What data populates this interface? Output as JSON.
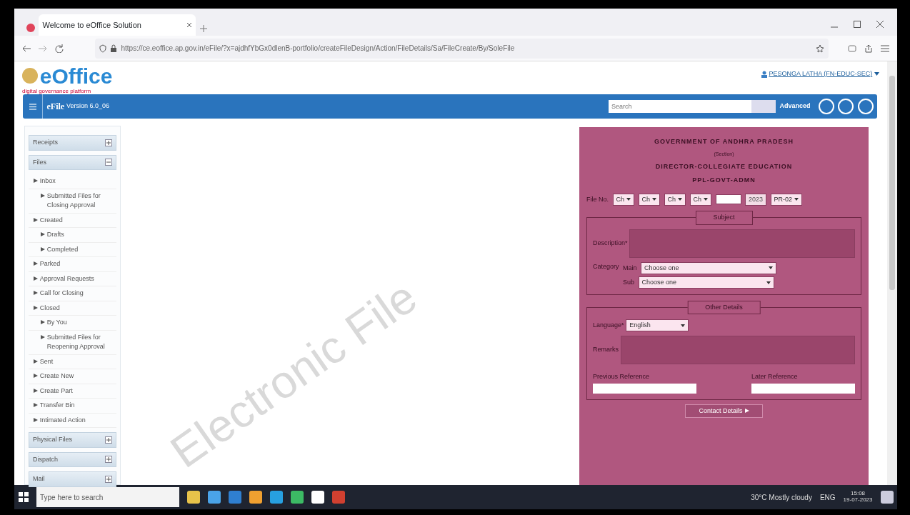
{
  "browser": {
    "tab_title": "Welcome to eOffice Solution",
    "url": "https://ce.eoffice.ap.gov.in/eFile/?x=ajdhfYbGx0dlenB-portfolio/createFileDesign/Action/FileDetails/Sa/FileCreate/By/SoleFile"
  },
  "app": {
    "logo": "eOffice",
    "logo_tagline": "digital governance platform",
    "user": "PESONGA LATHA (FN-EDUC-SEC)",
    "title": "eFile",
    "version": "Version 6.0_06",
    "search_placeholder": "Search",
    "advanced": "Advanced"
  },
  "sidebar": [
    {
      "label": "Receipts",
      "expanded": false
    },
    {
      "label": "Files",
      "expanded": true,
      "children": [
        {
          "label": "Inbox",
          "children": [
            {
              "label": "Submitted Files for Closing Approval"
            }
          ]
        },
        {
          "label": "Created",
          "children": [
            {
              "label": "Drafts"
            },
            {
              "label": "Completed"
            }
          ]
        },
        {
          "label": "Parked"
        },
        {
          "label": "Approval Requests"
        },
        {
          "label": "Call for Closing"
        },
        {
          "label": "Closed",
          "children": [
            {
              "label": "By You"
            },
            {
              "label": "Submitted Files for Reopening Approval"
            }
          ]
        },
        {
          "label": "Sent"
        },
        {
          "label": "Create New"
        },
        {
          "label": "Create Part"
        },
        {
          "label": "Transfer Bin"
        },
        {
          "label": "Intimated Action"
        }
      ]
    },
    {
      "label": "Physical Files",
      "expanded": false
    },
    {
      "label": "Dispatch",
      "expanded": false
    },
    {
      "label": "Mail",
      "expanded": false
    }
  ],
  "watermark": "Electronic File",
  "form": {
    "heading": [
      "GOVERNMENT OF ANDHRA PRADESH",
      "(Section)",
      "DIRECTOR-COLLEGIATE EDUCATION",
      "PPL-GOVT-ADMN"
    ],
    "file_no_label": "File No.",
    "file_no": [
      {
        "kind": "select",
        "value": "Ch"
      },
      {
        "kind": "select",
        "value": "Ch"
      },
      {
        "kind": "select",
        "value": "Ch"
      },
      {
        "kind": "select",
        "value": "Ch"
      },
      {
        "kind": "input"
      },
      {
        "kind": "fixed",
        "value": "2023"
      },
      {
        "kind": "select",
        "value": "PR-02"
      }
    ],
    "subject_legend": "Subject",
    "description_label": "Description*",
    "category_label": "Category",
    "main_label": "Main",
    "main_value": "Choose one",
    "sub_label": "Sub",
    "sub_value": "Choose one",
    "other_legend": "Other Details",
    "language_label": "Language*",
    "language_value": "English",
    "remarks_label": "Remarks",
    "previous_label": "Previous Reference",
    "later_label": "Later Reference",
    "more_button": "Contact Details"
  },
  "taskbar": {
    "search_placeholder": "Type here to search",
    "weather": "30°C Mostly cloudy",
    "language": "ENG",
    "time": "15:08",
    "date": "19-07-2023"
  }
}
